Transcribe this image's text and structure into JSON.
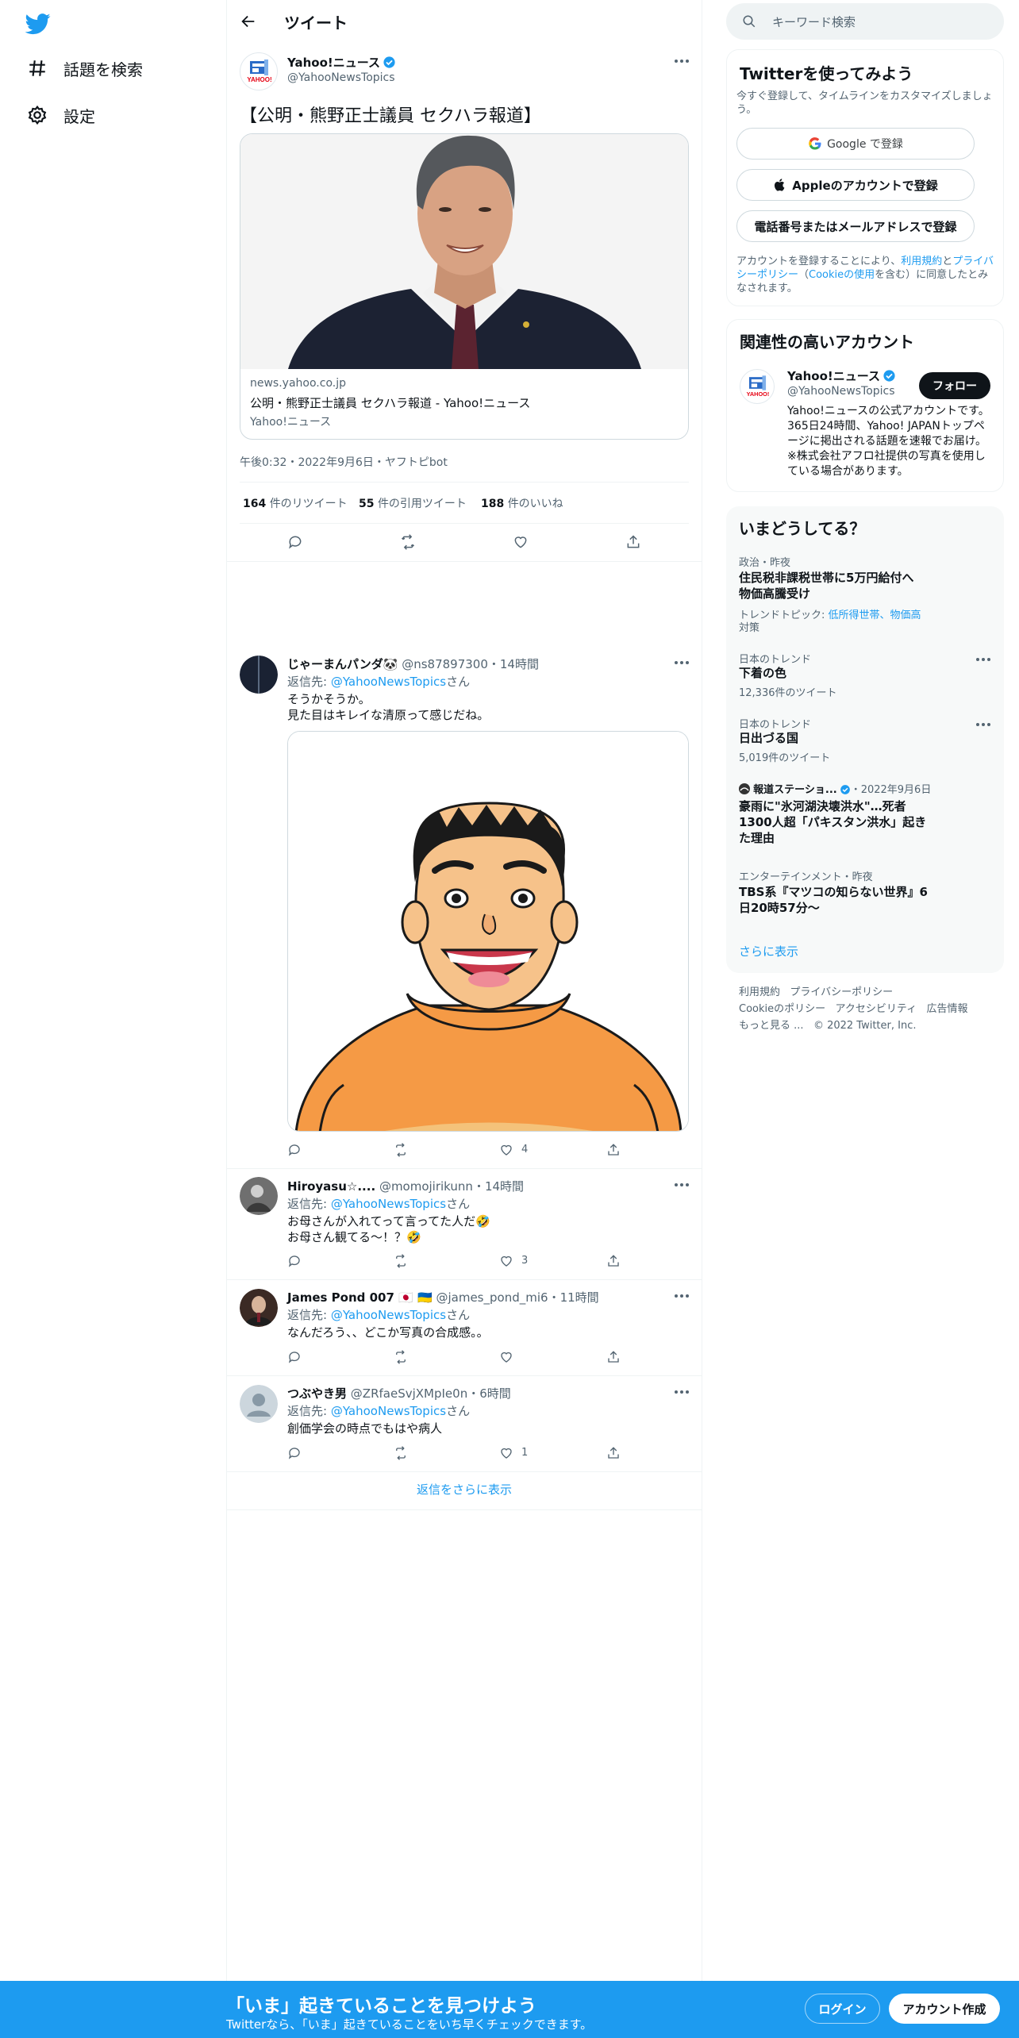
{
  "nav": {
    "explore": "話題を検索",
    "settings": "設定"
  },
  "header": {
    "title": "ツイート"
  },
  "main_tweet": {
    "name": "Yahoo!ニュース",
    "handle": "@YahooNewsTopics",
    "text": "【公明・熊野正士議員 セクハラ報道】",
    "card": {
      "domain": "news.yahoo.co.jp",
      "title": "公明・熊野正士議員 セクハラ報道 - Yahoo!ニュース",
      "source": "Yahoo!ニュース"
    },
    "timestamp": "午後0:32・2022年9月6日・ヤフトピbot",
    "retweets": "164",
    "retweets_label": "件のリツイート",
    "quotes": "55",
    "quotes_label": "件の引用ツイート",
    "likes": "188",
    "likes_label": "件のいいね"
  },
  "replies": [
    {
      "name": "じゃーまんパンダ🐼",
      "handle": "@ns87897300",
      "time": "・14時間",
      "reply_to_prefix": "返信先: ",
      "reply_to": "@YahooNewsTopics",
      "reply_to_suffix": "さん",
      "text1": "そうかそうか。",
      "text2": "見た目はキレイな清原って感じだね。",
      "likes": "4"
    },
    {
      "name": "Hiroyasu☆....",
      "handle": "@momojirikunn",
      "time": "・14時間",
      "reply_to_prefix": "返信先: ",
      "reply_to": "@YahooNewsTopics",
      "reply_to_suffix": "さん",
      "text1": "お母さんが入れてって言ってた人だ🤣",
      "text2": "お母さん観てる〜！？🤣",
      "likes": "3"
    },
    {
      "name": "James Pond 007 🇯🇵 🇺🇦",
      "handle": "@james_pond_mi6",
      "time": "・11時間",
      "reply_to_prefix": "返信先: ",
      "reply_to": "@YahooNewsTopics",
      "reply_to_suffix": "さん",
      "text1": "なんだろう、、どこか写真の合成感。。",
      "likes": ""
    },
    {
      "name": "つぶやき男",
      "handle": "@ZRfaeSvjXMpIe0n",
      "time": "・6時間",
      "reply_to_prefix": "返信先: ",
      "reply_to": "@YahooNewsTopics",
      "reply_to_suffix": "さん",
      "text1": "創価学会の時点でもはや病人",
      "likes": "1"
    }
  ],
  "show_more_replies": "返信をさらに表示",
  "right": {
    "search_placeholder": "キーワード検索",
    "signup": {
      "title": "Twitterを使ってみよう",
      "subtitle": "今すぐ登録して、タイムラインをカスタマイズしましょう。",
      "google": "Google で登録",
      "apple": "Appleのアカウントで登録",
      "phone": "電話番号またはメールアドレスで登録",
      "legal_1": "アカウントを登録することにより、",
      "legal_terms": "利用規約",
      "legal_2": "と",
      "legal_privacy": "プライバシーポリシー",
      "legal_3": "（",
      "legal_cookie": "Cookieの使用",
      "legal_4": "を含む）に同意したとみなされます。"
    },
    "related": {
      "title": "関連性の高いアカウント",
      "name": "Yahoo!ニュース",
      "handle": "@YahooNewsTopics",
      "follow": "フォロー",
      "bio": "Yahoo!ニュースの公式アカウントです。365日24時間、Yahoo! JAPANトップページに掲出される話題を速報でお届け。※株式会社アフロ社提供の写真を使用している場合があります。"
    },
    "trends": {
      "title": "いまどうしてる？",
      "items": [
        {
          "context": "政治・昨夜",
          "title_1": "住民税非課税世帯に5万円給付へ",
          "title_2": "物価高騰受け",
          "topic_label": "トレンドトピック: ",
          "topic_1": "低所得世帯、物価高",
          "topic_2": "対策"
        },
        {
          "context": "日本のトレンド",
          "title_1": "下着の色",
          "count": "12,336件のツイート"
        },
        {
          "context": "日本のトレンド",
          "title_1": "日出づる国",
          "count": "5,019件のツイート"
        },
        {
          "source": "報道ステーショ...",
          "date": "・2022年9月6日",
          "title_1": "豪雨に\"氷河湖決壊洪水\"…死者",
          "title_2": "1300人超「パキスタン洪水」起き",
          "title_3": "た理由"
        },
        {
          "context": "エンターテインメント・昨夜",
          "title_1": "TBS系『マツコの知らない世界』6",
          "title_2": "日20時57分〜"
        }
      ],
      "show_more": "さらに表示"
    },
    "footer": {
      "terms": "利用規約",
      "privacy": "プライバシーポリシー",
      "cookie": "Cookieのポリシー",
      "accessibility": "アクセシビリティ",
      "ads": "広告情報",
      "more": "もっと見る ...",
      "copyright": "© 2022 Twitter, Inc."
    }
  },
  "bottom_bar": {
    "headline": "「いま」起きていることを見つけよう",
    "sub": "Twitterなら、「いま」起きていることをいち早くチェックできます。",
    "login": "ログイン",
    "signup": "アカウント作成"
  },
  "colors": {
    "accent": "#1d9bf0",
    "text": "#0f1419",
    "muted": "#536471",
    "border": "#eff3f4"
  }
}
